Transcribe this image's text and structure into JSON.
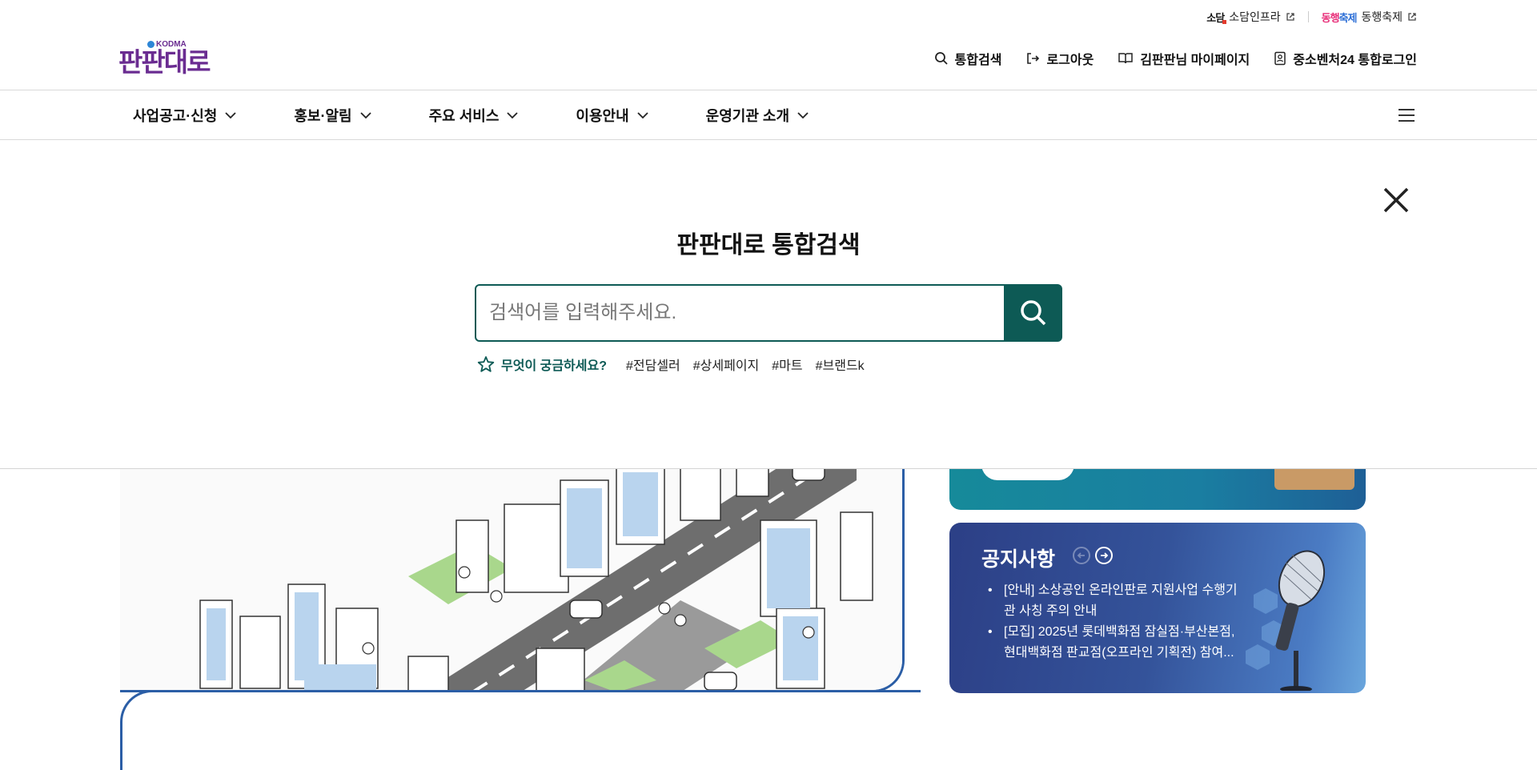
{
  "util_links": [
    {
      "logo_text": "소담",
      "label": "소담인프라"
    },
    {
      "logo_text_1": "동행",
      "logo_text_2": "축제",
      "label": "동행축제"
    }
  ],
  "logo": {
    "text": "판판대로",
    "badge": "KODMA"
  },
  "header_links": [
    {
      "icon": "search-icon",
      "label": "통합검색"
    },
    {
      "icon": "logout-icon",
      "label": "로그아웃"
    },
    {
      "icon": "book-icon",
      "label": "김판판님 마이페이지"
    },
    {
      "icon": "id-card-icon",
      "label": "중소벤처24 통합로그인"
    }
  ],
  "nav": [
    {
      "label": "사업공고·신청"
    },
    {
      "label": "홍보·알림"
    },
    {
      "label": "주요 서비스"
    },
    {
      "label": "이용안내"
    },
    {
      "label": "운영기관 소개"
    }
  ],
  "search": {
    "title": "판판대로 통합검색",
    "placeholder": "검색어를 입력해주세요.",
    "hint_label": "무엇이 궁금하세요?",
    "tags": [
      "#전담셀러",
      "#상세페이지",
      "#마트",
      "#브랜드k"
    ]
  },
  "notice": {
    "title": "공지사항",
    "items": [
      "[안내] 소상공인 온라인판로 지원사업 수행기관 사칭 주의 안내",
      "[모집] 2025년 롯데백화점 잠실점·부산본점, 현대백화점 판교점(오프라인 기획전) 참여..."
    ]
  },
  "colors": {
    "primary": "#0d5a55",
    "brand": "#6a2c91",
    "accent_blue": "#2b5ea6"
  }
}
